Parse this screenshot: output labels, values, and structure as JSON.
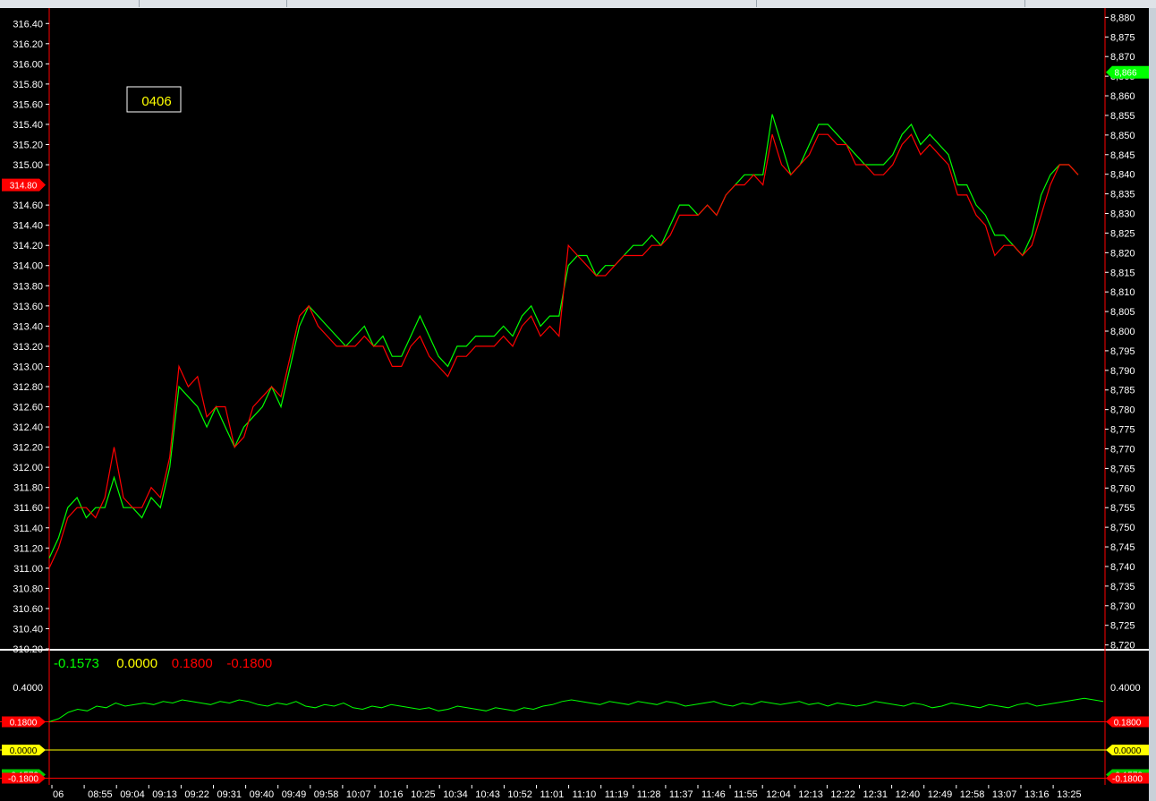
{
  "window": {
    "label_box": "0406"
  },
  "colors": {
    "background": "#000000",
    "series_a": "#00ff00",
    "series_b": "#ff0000",
    "zero_line": "#ffff00",
    "band_line": "#ff0000",
    "text": "#ffffff"
  },
  "chart_data": [
    {
      "type": "line",
      "left_axis": {
        "ticks": [
          "316.40",
          "316.20",
          "316.00",
          "315.80",
          "315.60",
          "315.40",
          "315.20",
          "315.00",
          "314.60",
          "314.40",
          "314.20",
          "314.00",
          "313.80",
          "313.60",
          "313.40",
          "313.20",
          "313.00",
          "312.80",
          "312.60",
          "312.40",
          "312.20",
          "312.00",
          "311.80",
          "311.60",
          "311.40",
          "311.20",
          "311.00",
          "310.80",
          "310.60",
          "310.40",
          "310.20"
        ],
        "ylim": [
          310.2,
          316.5
        ],
        "marker_label": "314.80",
        "marker_value": 314.8,
        "marker_color": "#ff0000"
      },
      "right_axis": {
        "ticks": [
          "8,880",
          "8,875",
          "8,870",
          "8,865",
          "8,860",
          "8,855",
          "8,850",
          "8,845",
          "8,840",
          "8,835",
          "8,830",
          "8,825",
          "8,820",
          "8,815",
          "8,810",
          "8,805",
          "8,800",
          "8,795",
          "8,790",
          "8,785",
          "8,780",
          "8,775",
          "8,770",
          "8,765",
          "8,760",
          "8,755",
          "8,750",
          "8,745",
          "8,740",
          "8,735",
          "8,730",
          "8,725",
          "8,720"
        ],
        "ylim": [
          8719,
          8881
        ],
        "marker_label": "8,866",
        "marker_value": 8866,
        "marker_color": "#00ff00"
      },
      "x_ticks": [
        "06",
        "08:55",
        "09:04",
        "09:13",
        "09:22",
        "09:31",
        "09:40",
        "09:49",
        "09:58",
        "10:07",
        "10:16",
        "10:25",
        "10:34",
        "10:43",
        "10:52",
        "11:01",
        "11:10",
        "11:19",
        "11:28",
        "11:37",
        "11:46",
        "11:55",
        "12:04",
        "12:13",
        "12:22",
        "12:31",
        "12:40",
        "12:49",
        "12:58",
        "13:07",
        "13:16",
        "13:25"
      ],
      "series": [
        {
          "color": "#00ff00",
          "axis": "left",
          "values": [
            311.1,
            311.3,
            311.6,
            311.7,
            311.5,
            311.6,
            311.6,
            311.9,
            311.6,
            311.6,
            311.5,
            311.7,
            311.6,
            312.0,
            312.8,
            312.7,
            312.6,
            312.4,
            312.6,
            312.4,
            312.2,
            312.4,
            312.5,
            312.6,
            312.8,
            312.6,
            313.0,
            313.4,
            313.6,
            313.5,
            313.4,
            313.3,
            313.2,
            313.3,
            313.4,
            313.2,
            313.3,
            313.1,
            313.1,
            313.3,
            313.5,
            313.3,
            313.1,
            313.0,
            313.2,
            313.2,
            313.3,
            313.3,
            313.3,
            313.4,
            313.3,
            313.5,
            313.6,
            313.4,
            313.5,
            313.5,
            314.0,
            314.1,
            314.1,
            313.9,
            314.0,
            314.0,
            314.1,
            314.2,
            314.2,
            314.3,
            314.2,
            314.4,
            314.6,
            314.6,
            314.5,
            314.6,
            314.5,
            314.7,
            314.8,
            314.9,
            314.9,
            314.9,
            315.5,
            315.2,
            314.9,
            315.0,
            315.2,
            315.4,
            315.4,
            315.3,
            315.2,
            315.1,
            315.0,
            315.0,
            315.0,
            315.1,
            315.3,
            315.4,
            315.2,
            315.3,
            315.2,
            315.1,
            314.8,
            314.8,
            314.6,
            314.5,
            314.3,
            314.3,
            314.2,
            314.1,
            314.3,
            314.7,
            314.9,
            315.0,
            315.0,
            314.9
          ]
        },
        {
          "color": "#ff0000",
          "axis": "left",
          "values": [
            311.0,
            311.2,
            311.5,
            311.6,
            311.6,
            311.5,
            311.7,
            312.2,
            311.7,
            311.6,
            311.6,
            311.8,
            311.7,
            312.1,
            313.0,
            312.8,
            312.9,
            312.5,
            312.6,
            312.6,
            312.2,
            312.3,
            312.6,
            312.7,
            312.8,
            312.7,
            313.1,
            313.5,
            313.6,
            313.4,
            313.3,
            313.2,
            313.2,
            313.2,
            313.3,
            313.2,
            313.2,
            313.0,
            313.0,
            313.2,
            313.3,
            313.1,
            313.0,
            312.9,
            313.1,
            313.1,
            313.2,
            313.2,
            313.2,
            313.3,
            313.2,
            313.4,
            313.5,
            313.3,
            313.4,
            313.3,
            314.2,
            314.1,
            314.0,
            313.9,
            313.9,
            314.0,
            314.1,
            314.1,
            314.1,
            314.2,
            314.2,
            314.3,
            314.5,
            314.5,
            314.5,
            314.6,
            314.5,
            314.7,
            314.8,
            314.8,
            314.9,
            314.8,
            315.3,
            315.0,
            314.9,
            315.0,
            315.1,
            315.3,
            315.3,
            315.2,
            315.2,
            315.0,
            315.0,
            314.9,
            314.9,
            315.0,
            315.2,
            315.3,
            315.1,
            315.2,
            315.1,
            315.0,
            314.7,
            314.7,
            314.5,
            314.4,
            314.1,
            314.2,
            314.2,
            314.1,
            314.2,
            314.5,
            314.8,
            315.0,
            315.0,
            314.9
          ]
        }
      ]
    },
    {
      "type": "line",
      "legend": [
        {
          "label": "-0.1573",
          "color": "#00ff00"
        },
        {
          "label": "0.0000",
          "color": "#ffff00"
        },
        {
          "label": "0.1800",
          "color": "#ff0000"
        },
        {
          "label": "-0.1800",
          "color": "#ff0000"
        }
      ],
      "left_ticks": [
        "0.4000"
      ],
      "right_ticks": [
        "0.4000"
      ],
      "ylim": [
        -0.2,
        0.6
      ],
      "zero_label": "0.0000",
      "upper_label": "0.1800",
      "lower_label": "-0.1800",
      "last_label": "-0.1573",
      "hlines": [
        {
          "value": 0.18,
          "color": "#ff0000"
        },
        {
          "value": 0.0,
          "color": "#ffff00"
        },
        {
          "value": -0.18,
          "color": "#ff0000"
        }
      ],
      "series": [
        {
          "color": "#00ff00",
          "values": [
            0.18,
            0.2,
            0.24,
            0.26,
            0.25,
            0.28,
            0.27,
            0.3,
            0.28,
            0.29,
            0.3,
            0.29,
            0.31,
            0.3,
            0.32,
            0.31,
            0.3,
            0.29,
            0.31,
            0.3,
            0.32,
            0.31,
            0.29,
            0.28,
            0.3,
            0.29,
            0.31,
            0.28,
            0.27,
            0.29,
            0.28,
            0.3,
            0.27,
            0.26,
            0.28,
            0.27,
            0.29,
            0.28,
            0.27,
            0.26,
            0.27,
            0.25,
            0.26,
            0.28,
            0.27,
            0.26,
            0.25,
            0.27,
            0.26,
            0.25,
            0.27,
            0.26,
            0.28,
            0.29,
            0.31,
            0.32,
            0.31,
            0.3,
            0.29,
            0.31,
            0.3,
            0.29,
            0.31,
            0.3,
            0.29,
            0.31,
            0.3,
            0.28,
            0.29,
            0.3,
            0.31,
            0.29,
            0.28,
            0.3,
            0.29,
            0.31,
            0.3,
            0.29,
            0.3,
            0.31,
            0.29,
            0.3,
            0.28,
            0.3,
            0.29,
            0.28,
            0.29,
            0.31,
            0.3,
            0.29,
            0.28,
            0.3,
            0.29,
            0.27,
            0.28,
            0.3,
            0.29,
            0.28,
            0.27,
            0.29,
            0.28,
            0.27,
            0.29,
            0.3,
            0.28,
            0.29,
            0.3,
            0.31,
            0.32,
            0.33,
            0.32,
            0.31
          ]
        }
      ]
    }
  ]
}
